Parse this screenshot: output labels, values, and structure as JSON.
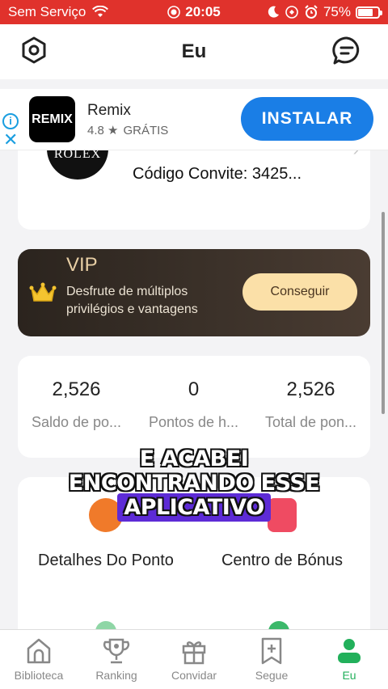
{
  "status_bar": {
    "carrier": "Sem Serviço",
    "time": "20:05",
    "battery": "75%",
    "battery_level": 0.75
  },
  "header": {
    "title": "Eu"
  },
  "ad": {
    "app_icon_text": "REMIX",
    "app_name": "Remix",
    "rating": "4.8 ★",
    "price": "GRÁTIS",
    "install_label": "INSTALAR",
    "info_glyph": "i",
    "close_glyph": "✕"
  },
  "profile": {
    "logo_text": "ROLEX",
    "invite_label": "Código Convite:",
    "invite_code": "3425...",
    "chevron": "›"
  },
  "vip": {
    "title": "VIP",
    "description": "Desfrute de múltiplos privilégios e vantagens",
    "button_label": "Conseguir"
  },
  "points": [
    {
      "value": "2,526",
      "label": "Saldo de po..."
    },
    {
      "value": "0",
      "label": "Pontos de h..."
    },
    {
      "value": "2,526",
      "label": "Total de pon..."
    }
  ],
  "menu": [
    {
      "label": "Detalhes Do Ponto",
      "icon": "coin-icon",
      "color": "#f07a2a"
    },
    {
      "label": "Centro de Bónus",
      "icon": "bonus-icon",
      "color": "#ef4b62"
    }
  ],
  "caption": {
    "line1": "E ACABEI",
    "line2": "ENCONTRANDO ESSE",
    "line3": "APLICATIVO"
  },
  "tabs": [
    {
      "label": "Biblioteca",
      "icon": "home-icon"
    },
    {
      "label": "Ranking",
      "icon": "trophy-icon"
    },
    {
      "label": "Convidar",
      "icon": "gift-icon"
    },
    {
      "label": "Segue",
      "icon": "bookmark-plus-icon"
    },
    {
      "label": "Eu",
      "icon": "user-icon",
      "active": true
    }
  ],
  "colors": {
    "status_bar": "#e0322c",
    "accent_green": "#22b05b",
    "install_blue": "#1a7ee6",
    "vip_button": "#fbe0a8"
  }
}
